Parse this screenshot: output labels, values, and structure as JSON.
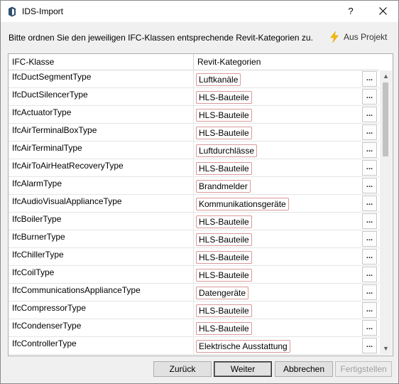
{
  "window": {
    "title": "IDS-Import",
    "help_label": "?",
    "close_icon": "close-icon",
    "app_icon": "ids-import-app-icon"
  },
  "instruction": "Bitte ordnen Sie den jeweiligen IFC-Klassen entsprechende Revit-Kategorien zu.",
  "from_project": {
    "label": "Aus Projekt",
    "icon": "lightning-icon",
    "accent": "#f5b800"
  },
  "grid": {
    "columns": [
      "IFC-Klasse",
      "Revit-Kategorien"
    ],
    "browse_label": "...",
    "tag_border_color": "#d99a9a",
    "rows": [
      {
        "ifc": "IfcDuctSegmentType",
        "category": "Luftkanäle"
      },
      {
        "ifc": "IfcDuctSilencerType",
        "category": "HLS-Bauteile"
      },
      {
        "ifc": "IfcActuatorType",
        "category": "HLS-Bauteile"
      },
      {
        "ifc": "IfcAirTerminalBoxType",
        "category": "HLS-Bauteile"
      },
      {
        "ifc": "IfcAirTerminalType",
        "category": "Luftdurchlässe"
      },
      {
        "ifc": "IfcAirToAirHeatRecoveryType",
        "category": "HLS-Bauteile"
      },
      {
        "ifc": "IfcAlarmType",
        "category": "Brandmelder"
      },
      {
        "ifc": "IfcAudioVisualApplianceType",
        "category": "Kommunikationsgeräte"
      },
      {
        "ifc": "IfcBoilerType",
        "category": "HLS-Bauteile"
      },
      {
        "ifc": "IfcBurnerType",
        "category": "HLS-Bauteile"
      },
      {
        "ifc": "IfcChillerType",
        "category": "HLS-Bauteile"
      },
      {
        "ifc": "IfcCoilType",
        "category": "HLS-Bauteile"
      },
      {
        "ifc": "IfcCommunicationsApplianceType",
        "category": "Datengeräte"
      },
      {
        "ifc": "IfcCompressorType",
        "category": "HLS-Bauteile"
      },
      {
        "ifc": "IfcCondenserType",
        "category": "HLS-Bauteile"
      },
      {
        "ifc": "IfcControllerType",
        "category": "Elektrische Ausstattung"
      }
    ]
  },
  "buttons": {
    "back": "Zurück",
    "next": "Weiter",
    "cancel": "Abbrechen",
    "finish": "Fertigstellen"
  }
}
